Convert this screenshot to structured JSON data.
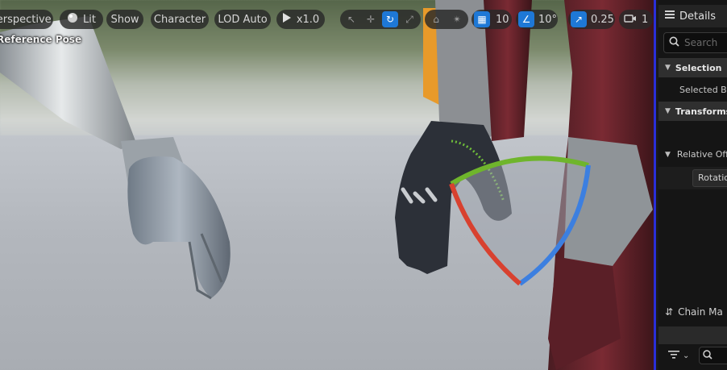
{
  "viewport": {
    "toolbar": {
      "perspective_label": "Perspective",
      "lit_label": "Lit",
      "show_label": "Show",
      "character_label": "Character",
      "lod_label": "LOD Auto",
      "play_rate_label": "x1.0",
      "grid_snap_value": "10",
      "rotation_snap_value": "10°",
      "scale_snap_value": "0.25",
      "camera_speed_value": "1"
    },
    "overlay_text": "Reference Pose",
    "accent_color": "#1e78d6",
    "gizmo_colors": {
      "x": "#d8412f",
      "y": "#6fb52c",
      "z": "#3c7fe0"
    }
  },
  "details_panel": {
    "title": "Details",
    "search_placeholder": "Search",
    "sections": [
      {
        "label": "Selection"
      },
      {
        "label": "Transforms"
      },
      {
        "label": "Relative Off"
      }
    ],
    "selection_field": "Selected Bo",
    "rotation_field": "Rotatio",
    "chain_label": "Chain Ma"
  }
}
